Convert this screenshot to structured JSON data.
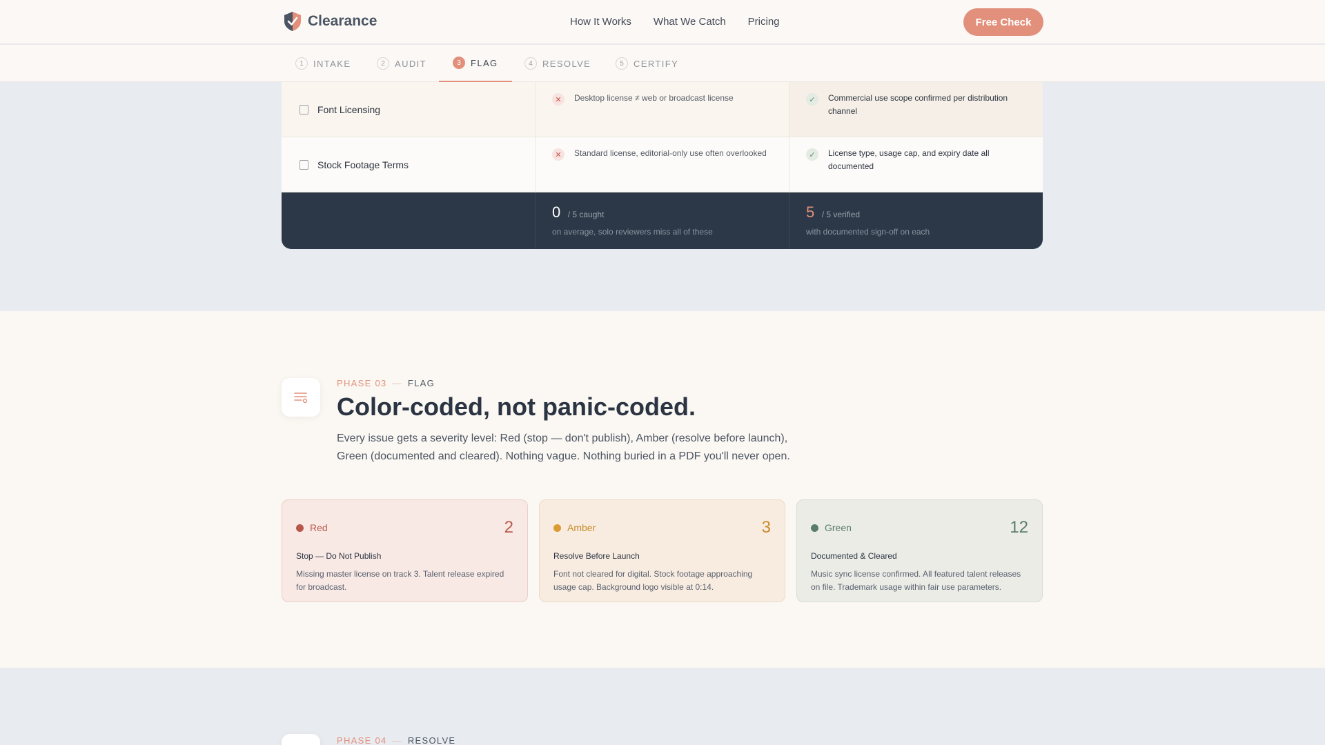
{
  "header": {
    "brand_name": "Clearance",
    "nav": [
      "How It Works",
      "What We Catch",
      "Pricing"
    ],
    "cta_label": "Free Check"
  },
  "steps": [
    {
      "num": "1",
      "label": "INTAKE"
    },
    {
      "num": "2",
      "label": "AUDIT"
    },
    {
      "num": "3",
      "label": "FLAG",
      "active": true
    },
    {
      "num": "4",
      "label": "RESOLVE"
    },
    {
      "num": "5",
      "label": "CERTIFY"
    }
  ],
  "table": {
    "rows": [
      {
        "label": "Font Licensing",
        "miss": "Desktop license ≠ web or broadcast license",
        "check": "Commercial use scope confirmed per distribution channel"
      },
      {
        "label": "Stock Footage Terms",
        "miss": "Standard license, editorial-only use often overlooked",
        "check": "License type, usage cap, and expiry date all documented"
      }
    ],
    "footer": {
      "caught_value": "0",
      "caught_label": "/ 5 caught",
      "caught_sub": "on average, solo reviewers miss all of these",
      "verified_value": "5",
      "verified_label": "/ 5 verified",
      "verified_sub": "with documented sign-off on each"
    }
  },
  "phase3": {
    "phase": "PHASE 03",
    "name": "FLAG",
    "headline": "Color-coded, not panic-coded.",
    "lede": "Every issue gets a severity level: Red (stop — don't publish), Amber (resolve before launch), Green (documented and cleared). Nothing vague. Nothing buried in a PDF you'll never open.",
    "cards": [
      {
        "tag": "Red",
        "count": "2",
        "title": "Stop — Do Not Publish",
        "desc": "Missing master license on track 3. Talent release expired for broadcast.",
        "color": "#c0574a"
      },
      {
        "tag": "Amber",
        "count": "3",
        "title": "Resolve Before Launch",
        "desc": "Font not cleared for digital. Stock footage approaching usage cap. Background logo visible at 0:14.",
        "color": "#d9952f"
      },
      {
        "tag": "Green",
        "count": "12",
        "title": "Documented & Cleared",
        "desc": "Music sync license confirmed. All featured talent releases on file. Trademark usage within fair use parameters.",
        "color": "#5a7d6a"
      }
    ]
  },
  "phase4": {
    "phase": "PHASE 04",
    "name": "RESOLVE"
  },
  "colors": {
    "accent": "#e2907c",
    "dark_footer": "#2c3847",
    "cream": "#fbf7f2"
  }
}
